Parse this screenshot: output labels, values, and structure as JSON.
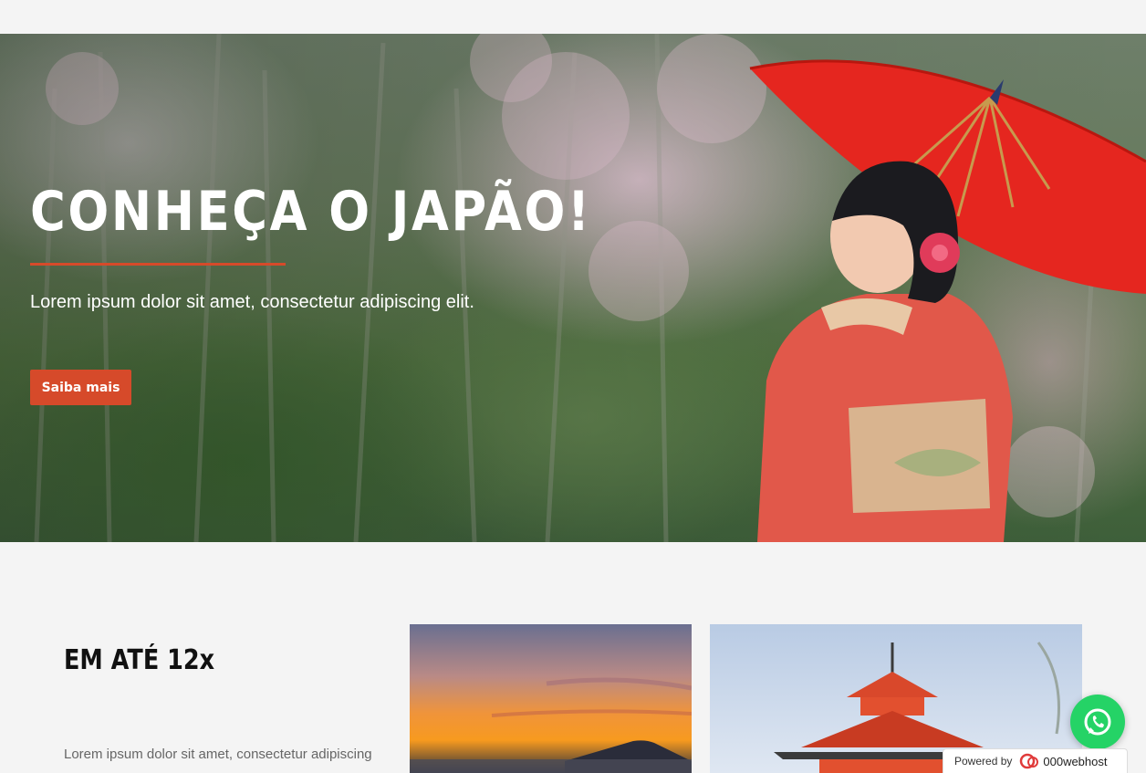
{
  "hero": {
    "title": "CONHEÇA O JAPÃO!",
    "subtitle": "Lorem ipsum dolor sit amet, consectetur adipiscing elit.",
    "button_label": "Saiba mais"
  },
  "promo": {
    "title": "EM ATÉ 12x",
    "text": "Lorem ipsum dolor sit amet, consectetur adipiscing"
  },
  "widgets": {
    "whatsapp_icon": "whatsapp-icon",
    "powered_label": "Powered by",
    "host_name": "000webhost"
  },
  "colors": {
    "accent": "#d64a2a",
    "whatsapp": "#25d366"
  }
}
